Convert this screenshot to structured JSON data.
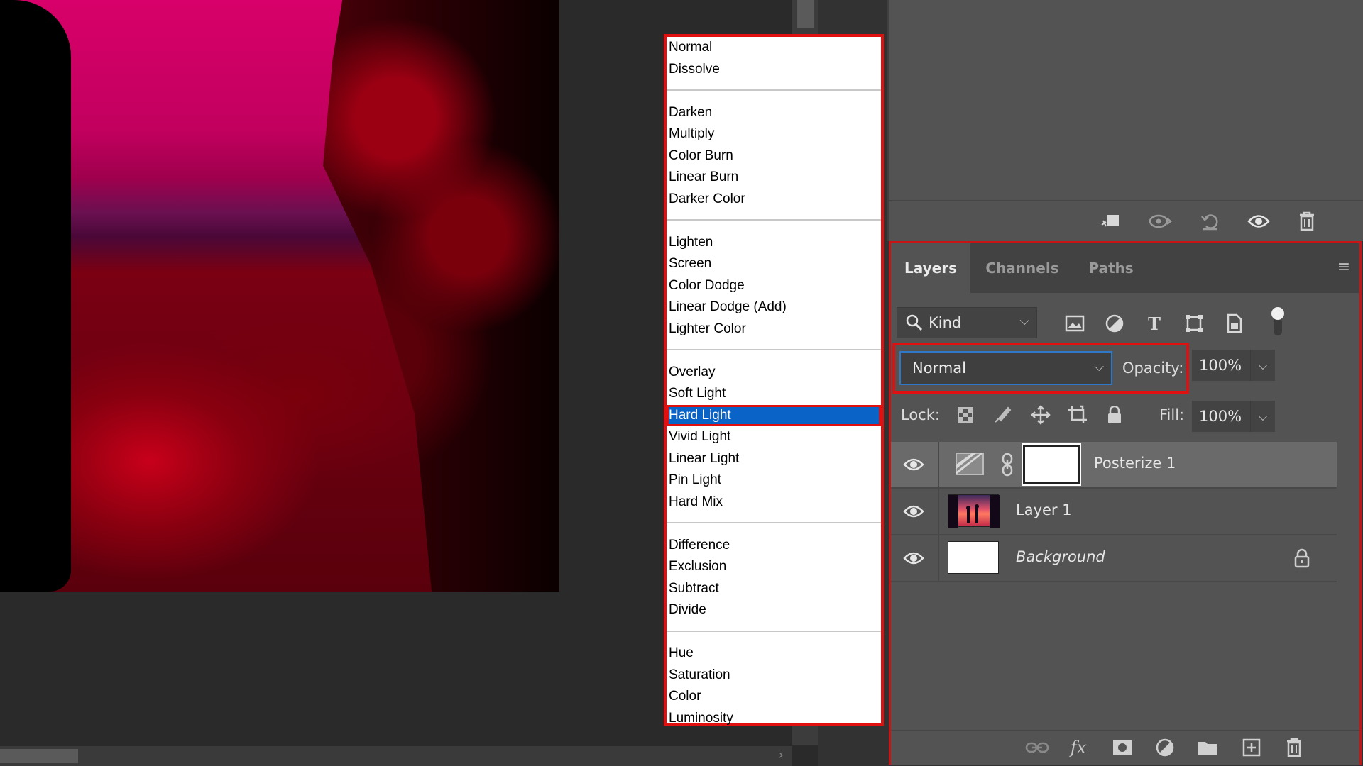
{
  "blend_modes": {
    "groups": [
      [
        "Normal",
        "Dissolve"
      ],
      [
        "Darken",
        "Multiply",
        "Color Burn",
        "Linear Burn",
        "Darker Color"
      ],
      [
        "Lighten",
        "Screen",
        "Color Dodge",
        "Linear Dodge (Add)",
        "Lighter Color"
      ],
      [
        "Overlay",
        "Soft Light",
        "Hard Light",
        "Vivid Light",
        "Linear Light",
        "Pin Light",
        "Hard Mix"
      ],
      [
        "Difference",
        "Exclusion",
        "Subtract",
        "Divide"
      ],
      [
        "Hue",
        "Saturation",
        "Color",
        "Luminosity"
      ]
    ],
    "selected": "Hard Light"
  },
  "layers_panel": {
    "tabs": [
      "Layers",
      "Channels",
      "Paths"
    ],
    "active_tab": "Layers",
    "filter": {
      "label": "Kind"
    },
    "blend_mode": "Normal",
    "opacity_label": "Opacity:",
    "opacity_value": "100%",
    "lock_label": "Lock:",
    "fill_label": "Fill:",
    "fill_value": "100%",
    "layers": [
      {
        "name": "Posterize 1",
        "type": "adjustment",
        "visible": true,
        "selected": true
      },
      {
        "name": "Layer 1",
        "type": "image",
        "visible": true,
        "selected": false
      },
      {
        "name": "Background",
        "type": "background",
        "visible": true,
        "selected": false,
        "locked": true
      }
    ]
  },
  "colors": {
    "highlight": "#0a64c8",
    "annotation_red": "#e01010",
    "panel_bg": "#535353"
  }
}
